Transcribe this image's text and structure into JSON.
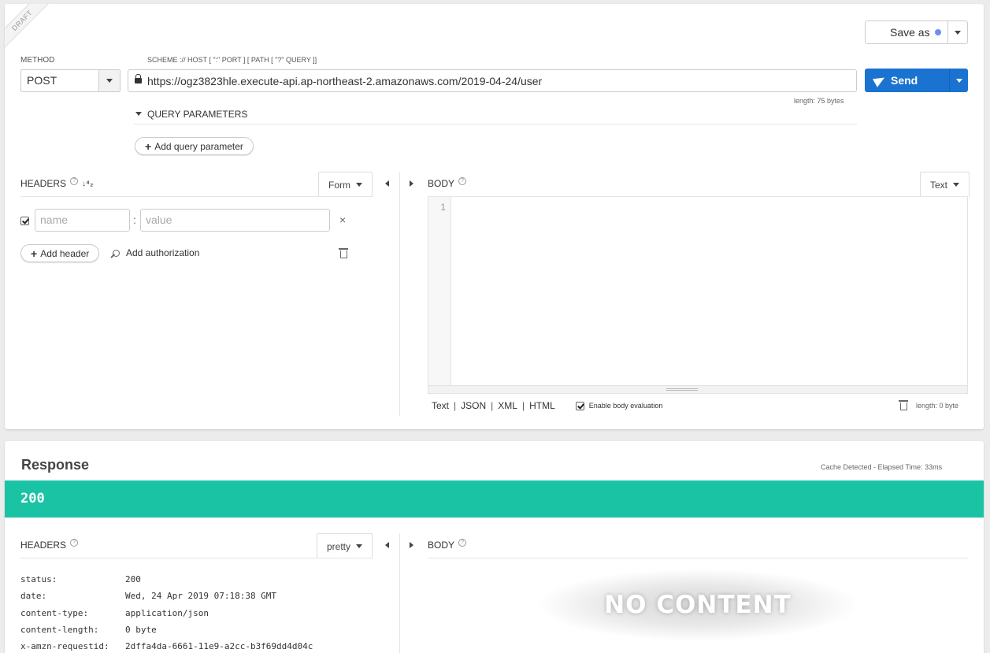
{
  "draft_label": "DRAFT",
  "save": {
    "label": "Save as",
    "dot_color": "#6e8ef5"
  },
  "method": {
    "label": "METHOD",
    "value": "POST"
  },
  "url": {
    "label": "SCHEME :// HOST [ \":\" PORT ] [ PATH [ \"?\" QUERY ]]",
    "value": "https://ogz3823hle.execute-api.ap-northeast-2.amazonaws.com/2019-04-24/user",
    "length": "length: 75 bytes"
  },
  "send": {
    "label": "Send",
    "color": "#1a73d1"
  },
  "query": {
    "title": "QUERY PARAMETERS",
    "add_label": "Add query parameter"
  },
  "request_headers": {
    "title": "HEADERS",
    "mode": "Form",
    "name_placeholder": "name",
    "value_placeholder": "value",
    "separator": ":",
    "add_header": "Add header",
    "add_auth": "Add authorization"
  },
  "request_body": {
    "title": "BODY",
    "mode": "Text",
    "line_number": "1",
    "formats": [
      "Text",
      "JSON",
      "XML",
      "HTML"
    ],
    "enable_eval": "Enable body evaluation",
    "length": "length: 0 byte"
  },
  "response": {
    "title": "Response",
    "meta": "Cache Detected - Elapsed Time: 33ms",
    "status": "200",
    "status_color": "#1bc3a5",
    "headers_title": "HEADERS",
    "headers_mode": "pretty",
    "body_title": "BODY",
    "no_content": "NO CONTENT",
    "headers": [
      {
        "key": "status:",
        "value": "200"
      },
      {
        "key": "date:",
        "value": "Wed, 24 Apr 2019 07:18:38 GMT"
      },
      {
        "key": "content-type:",
        "value": "application/json"
      },
      {
        "key": "content-length:",
        "value": "0 byte"
      },
      {
        "key": "x-amzn-requestid:",
        "value": "2dffa4da-6661-11e9-a2cc-b3f69dd4d04c"
      }
    ]
  }
}
